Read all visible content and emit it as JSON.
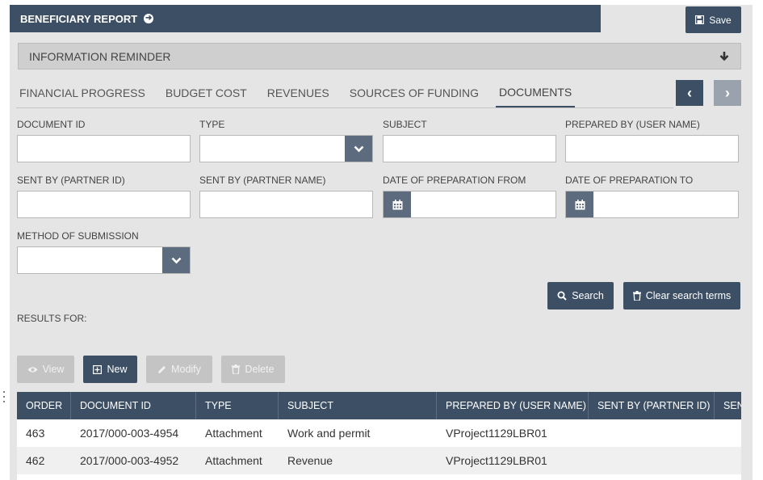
{
  "header": {
    "title": "BENEFICIARY REPORT",
    "save_label": "Save"
  },
  "reminder": {
    "label": "INFORMATION REMINDER"
  },
  "tabs": [
    {
      "label": "FINANCIAL PROGRESS"
    },
    {
      "label": "BUDGET COST"
    },
    {
      "label": "REVENUES"
    },
    {
      "label": "SOURCES OF FUNDING"
    },
    {
      "label": "DOCUMENTS",
      "active": true
    }
  ],
  "filters": {
    "document_id": {
      "label": "DOCUMENT ID",
      "value": ""
    },
    "type": {
      "label": "TYPE",
      "value": ""
    },
    "subject": {
      "label": "SUBJECT",
      "value": ""
    },
    "prepared_by": {
      "label": "PREPARED BY (USER NAME)",
      "value": ""
    },
    "sent_by_id": {
      "label": "SENT BY (PARTNER ID)",
      "value": ""
    },
    "sent_by_name": {
      "label": "SENT BY (PARTNER NAME)",
      "value": ""
    },
    "date_from": {
      "label": "DATE OF PREPARATION FROM",
      "value": ""
    },
    "date_to": {
      "label": "DATE OF PREPARATION TO",
      "value": ""
    },
    "method": {
      "label": "METHOD OF SUBMISSION",
      "value": ""
    }
  },
  "actions": {
    "search_label": "Search",
    "clear_label": "Clear search terms"
  },
  "results": {
    "label": "RESULTS FOR:"
  },
  "toolbar": {
    "view": "View",
    "new": "New",
    "modify": "Modify",
    "delete": "Delete"
  },
  "table": {
    "columns": [
      "ORDER",
      "DOCUMENT ID",
      "TYPE",
      "SUBJECT",
      "PREPARED BY (USER NAME)",
      "SENT BY (PARTNER ID)",
      "SEN"
    ],
    "rows": [
      [
        "463",
        "2017/000-003-4954",
        "Attachment",
        "Work and permit",
        "VProject1129LBR01",
        "",
        ""
      ],
      [
        "462",
        "2017/000-003-4952",
        "Attachment",
        "Revenue",
        "VProject1129LBR01",
        "",
        ""
      ]
    ]
  },
  "colors": {
    "primary": "#3d4f64",
    "dropdown": "#5c6b7d",
    "disabled": "#c4c4c4",
    "panel": "#e5e5e5"
  }
}
